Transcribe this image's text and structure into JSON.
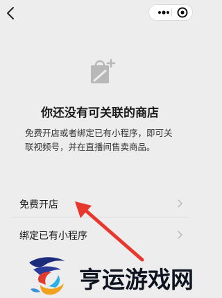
{
  "nav": {
    "back_icon": "chevron-left-icon",
    "more_icon": "more-dots-icon",
    "close_icon": "target-close-icon"
  },
  "empty_state": {
    "icon": "shopping-bag-plus-icon",
    "title": "你还没有可关联的商店",
    "description": "免费开店或者绑定已有小程序，即可关联视频号，并在直播间售卖商品。"
  },
  "options": [
    {
      "label": "免费开店"
    },
    {
      "label": "绑定已有小程序"
    }
  ],
  "annotation": {
    "arrow_color": "#e8372c"
  },
  "watermark": {
    "text": "亨运游戏网"
  }
}
